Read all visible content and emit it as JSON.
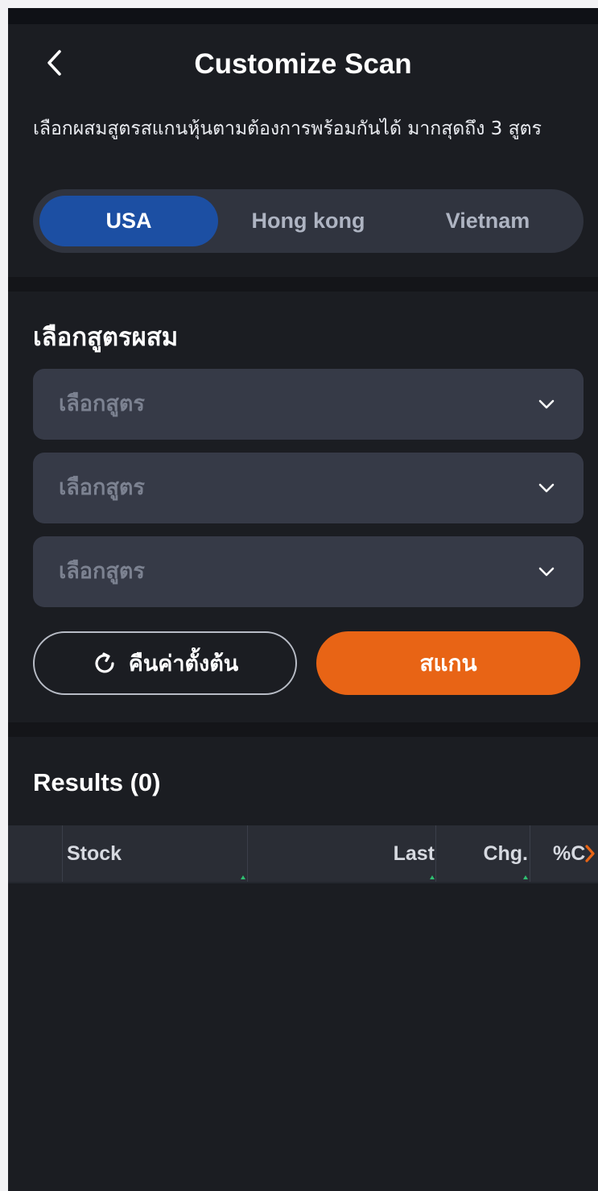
{
  "header": {
    "title": "Customize Scan",
    "back_icon": "chevron-left-icon"
  },
  "intro": {
    "text": "เลือกผสมสูตรสแกนหุ้นตามต้องการพร้อมกันได้ มากสุดถึง 3 สูตร"
  },
  "markets": {
    "tabs": [
      "USA",
      "Hong kong",
      "Vietnam"
    ],
    "selected": "USA"
  },
  "formula_section": {
    "title": "เลือกสูตรผสม",
    "selects": [
      {
        "placeholder": "เลือกสูตร"
      },
      {
        "placeholder": "เลือกสูตร"
      },
      {
        "placeholder": "เลือกสูตร"
      }
    ],
    "dropdown_icon": "chevron-down-icon"
  },
  "actions": {
    "reset_label": "คืนค่าตั้งต้น",
    "reset_icon": "refresh-icon",
    "scan_label": "สแกน"
  },
  "results": {
    "title": "Results (0)",
    "columns": [
      "Stock",
      "Last",
      "Chg.",
      "%C"
    ],
    "more_icon": "chevron-right-icon",
    "rows": []
  },
  "colors": {
    "background": "#1b1d22",
    "accent_blue": "#1c4fa3",
    "accent_orange": "#e86415",
    "sort_indicator": "#2fbf71"
  }
}
